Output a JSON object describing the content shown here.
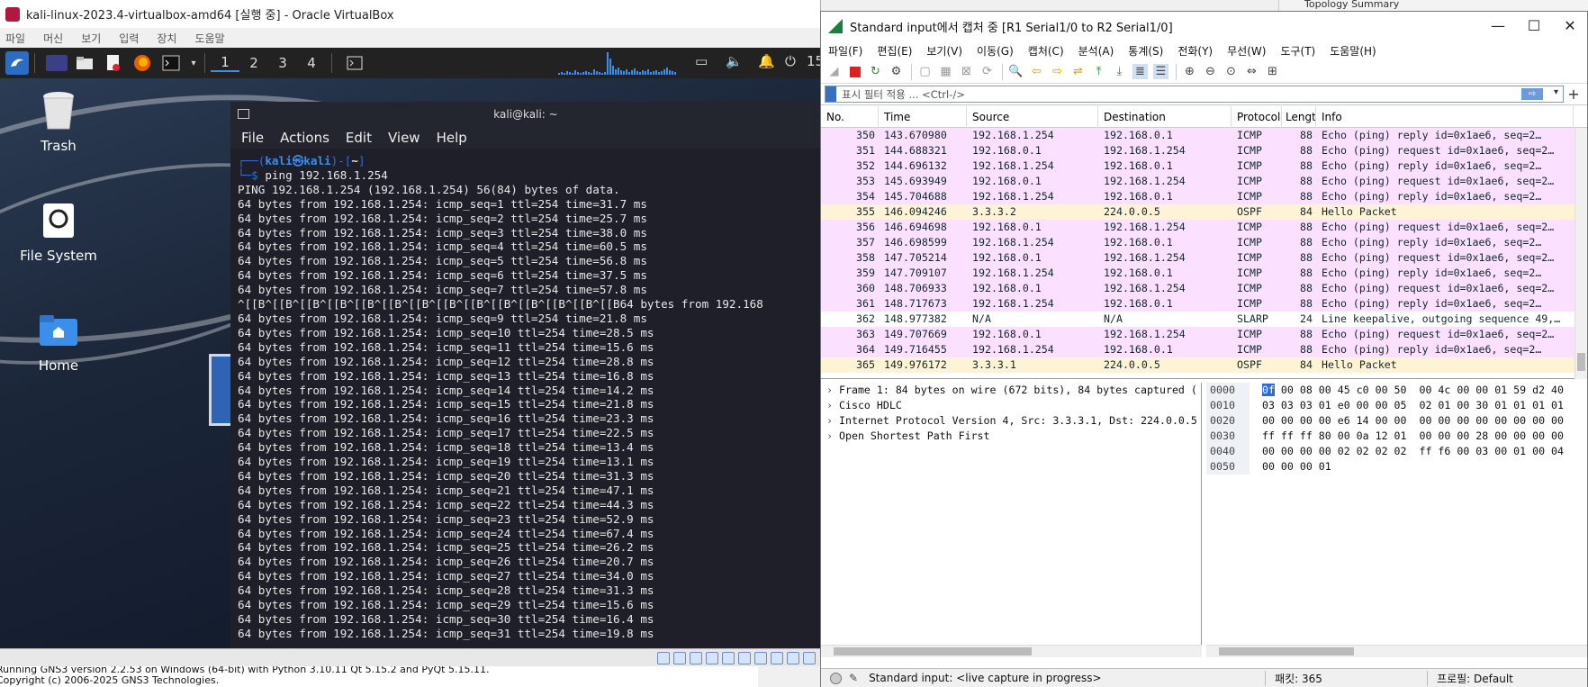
{
  "gns3": {
    "log_lines": [
      "Running GNS3 version 2.2.53 on Windows (64-bit) with Python 3.10.11 Qt 5.15.2 and PyQt 5.15.11.",
      "Copyright (c) 2006-2025 GNS3 Technologies."
    ],
    "topology_title": "Topology Summary"
  },
  "vbox": {
    "title": "kali-linux-2023.4-virtualbox-amd64 [실행 중] - Oracle VirtualBox",
    "menu": [
      "파일",
      "머신",
      "보기",
      "입력",
      "장치",
      "도움말"
    ]
  },
  "kali": {
    "workspaces": [
      "1",
      "2",
      "3",
      "4"
    ],
    "clock_partial": "15",
    "desktop_icons": [
      "Trash",
      "File System",
      "Home"
    ],
    "terminal": {
      "title": "kali@kali: ~",
      "menu": [
        "File",
        "Actions",
        "Edit",
        "View",
        "Help"
      ],
      "prompt_user": "kali",
      "prompt_host": "kali",
      "prompt_dir": "~",
      "command": "ping 192.168.1.254",
      "output_lines": [
        "PING 192.168.1.254 (192.168.1.254) 56(84) bytes of data.",
        "64 bytes from 192.168.1.254: icmp_seq=1 ttl=254 time=31.7 ms",
        "64 bytes from 192.168.1.254: icmp_seq=2 ttl=254 time=25.7 ms",
        "64 bytes from 192.168.1.254: icmp_seq=3 ttl=254 time=38.0 ms",
        "64 bytes from 192.168.1.254: icmp_seq=4 ttl=254 time=60.5 ms",
        "64 bytes from 192.168.1.254: icmp_seq=5 ttl=254 time=56.8 ms",
        "64 bytes from 192.168.1.254: icmp_seq=6 ttl=254 time=37.5 ms",
        "64 bytes from 192.168.1.254: icmp_seq=7 ttl=254 time=57.8 ms",
        "^[[B^[[B^[[B^[[B^[[B^[[B^[[B^[[B^[[B^[[B^[[B^[[B^[[B^[[B64 bytes from 192.168",
        "64 bytes from 192.168.1.254: icmp_seq=9 ttl=254 time=21.8 ms",
        "64 bytes from 192.168.1.254: icmp_seq=10 ttl=254 time=28.5 ms",
        "64 bytes from 192.168.1.254: icmp_seq=11 ttl=254 time=15.6 ms",
        "64 bytes from 192.168.1.254: icmp_seq=12 ttl=254 time=28.8 ms",
        "64 bytes from 192.168.1.254: icmp_seq=13 ttl=254 time=16.8 ms",
        "64 bytes from 192.168.1.254: icmp_seq=14 ttl=254 time=14.2 ms",
        "64 bytes from 192.168.1.254: icmp_seq=15 ttl=254 time=21.8 ms",
        "64 bytes from 192.168.1.254: icmp_seq=16 ttl=254 time=23.3 ms",
        "64 bytes from 192.168.1.254: icmp_seq=17 ttl=254 time=22.5 ms",
        "64 bytes from 192.168.1.254: icmp_seq=18 ttl=254 time=13.4 ms",
        "64 bytes from 192.168.1.254: icmp_seq=19 ttl=254 time=13.1 ms",
        "64 bytes from 192.168.1.254: icmp_seq=20 ttl=254 time=31.3 ms",
        "64 bytes from 192.168.1.254: icmp_seq=21 ttl=254 time=47.1 ms",
        "64 bytes from 192.168.1.254: icmp_seq=22 ttl=254 time=44.3 ms",
        "64 bytes from 192.168.1.254: icmp_seq=23 ttl=254 time=52.9 ms",
        "64 bytes from 192.168.1.254: icmp_seq=24 ttl=254 time=67.4 ms",
        "64 bytes from 192.168.1.254: icmp_seq=25 ttl=254 time=26.2 ms",
        "64 bytes from 192.168.1.254: icmp_seq=26 ttl=254 time=20.7 ms",
        "64 bytes from 192.168.1.254: icmp_seq=27 ttl=254 time=34.0 ms",
        "64 bytes from 192.168.1.254: icmp_seq=28 ttl=254 time=31.3 ms",
        "64 bytes from 192.168.1.254: icmp_seq=29 ttl=254 time=15.6 ms",
        "64 bytes from 192.168.1.254: icmp_seq=30 ttl=254 time=16.4 ms",
        "64 bytes from 192.168.1.254: icmp_seq=31 ttl=254 time=19.8 ms"
      ]
    }
  },
  "wireshark": {
    "title": "Standard input에서 캡처 중 [R1 Serial1/0 to R2 Serial1/0]",
    "menu": [
      "파일(F)",
      "편집(E)",
      "보기(V)",
      "이동(G)",
      "캡처(C)",
      "분석(A)",
      "통계(S)",
      "전화(Y)",
      "무선(W)",
      "도구(T)",
      "도움말(H)"
    ],
    "filter_placeholder": "표시 필터 적용 ... <Ctrl-/>",
    "columns": [
      "No.",
      "Time",
      "Source",
      "Destination",
      "Protocol",
      "Lengt",
      "Info"
    ],
    "colors": {
      "icmp": "#fce0ff",
      "ospf": "#fff3d6",
      "slarp": "#ffffff"
    },
    "packets": [
      {
        "no": "350",
        "time": "143.670980",
        "src": "192.168.1.254",
        "dst": "192.168.0.1",
        "proto": "ICMP",
        "len": "88",
        "info": "Echo (ping) reply    id=0x1ae6, seq=2…"
      },
      {
        "no": "351",
        "time": "144.688321",
        "src": "192.168.0.1",
        "dst": "192.168.1.254",
        "proto": "ICMP",
        "len": "88",
        "info": "Echo (ping) request  id=0x1ae6, seq=2…"
      },
      {
        "no": "352",
        "time": "144.696132",
        "src": "192.168.1.254",
        "dst": "192.168.0.1",
        "proto": "ICMP",
        "len": "88",
        "info": "Echo (ping) reply    id=0x1ae6, seq=2…"
      },
      {
        "no": "353",
        "time": "145.693949",
        "src": "192.168.0.1",
        "dst": "192.168.1.254",
        "proto": "ICMP",
        "len": "88",
        "info": "Echo (ping) request  id=0x1ae6, seq=2…"
      },
      {
        "no": "354",
        "time": "145.704688",
        "src": "192.168.1.254",
        "dst": "192.168.0.1",
        "proto": "ICMP",
        "len": "88",
        "info": "Echo (ping) reply    id=0x1ae6, seq=2…"
      },
      {
        "no": "355",
        "time": "146.094246",
        "src": "3.3.3.2",
        "dst": "224.0.0.5",
        "proto": "OSPF",
        "len": "84",
        "info": "Hello Packet"
      },
      {
        "no": "356",
        "time": "146.694698",
        "src": "192.168.0.1",
        "dst": "192.168.1.254",
        "proto": "ICMP",
        "len": "88",
        "info": "Echo (ping) request  id=0x1ae6, seq=2…"
      },
      {
        "no": "357",
        "time": "146.698599",
        "src": "192.168.1.254",
        "dst": "192.168.0.1",
        "proto": "ICMP",
        "len": "88",
        "info": "Echo (ping) reply    id=0x1ae6, seq=2…"
      },
      {
        "no": "358",
        "time": "147.705214",
        "src": "192.168.0.1",
        "dst": "192.168.1.254",
        "proto": "ICMP",
        "len": "88",
        "info": "Echo (ping) request  id=0x1ae6, seq=2…"
      },
      {
        "no": "359",
        "time": "147.709107",
        "src": "192.168.1.254",
        "dst": "192.168.0.1",
        "proto": "ICMP",
        "len": "88",
        "info": "Echo (ping) reply    id=0x1ae6, seq=2…"
      },
      {
        "no": "360",
        "time": "148.706933",
        "src": "192.168.0.1",
        "dst": "192.168.1.254",
        "proto": "ICMP",
        "len": "88",
        "info": "Echo (ping) request  id=0x1ae6, seq=2…"
      },
      {
        "no": "361",
        "time": "148.717673",
        "src": "192.168.1.254",
        "dst": "192.168.0.1",
        "proto": "ICMP",
        "len": "88",
        "info": "Echo (ping) reply    id=0x1ae6, seq=2…"
      },
      {
        "no": "362",
        "time": "148.977382",
        "src": "N/A",
        "dst": "N/A",
        "proto": "SLARP",
        "len": "24",
        "info": "Line keepalive, outgoing sequence 49,…"
      },
      {
        "no": "363",
        "time": "149.707669",
        "src": "192.168.0.1",
        "dst": "192.168.1.254",
        "proto": "ICMP",
        "len": "88",
        "info": "Echo (ping) request  id=0x1ae6, seq=2…"
      },
      {
        "no": "364",
        "time": "149.716455",
        "src": "192.168.1.254",
        "dst": "192.168.0.1",
        "proto": "ICMP",
        "len": "88",
        "info": "Echo (ping) reply    id=0x1ae6, seq=2…"
      },
      {
        "no": "365",
        "time": "149.976172",
        "src": "3.3.3.1",
        "dst": "224.0.0.5",
        "proto": "OSPF",
        "len": "84",
        "info": "Hello Packet"
      }
    ],
    "details": [
      "Frame 1: 84 bytes on wire (672 bits), 84 bytes captured (",
      "Cisco HDLC",
      "Internet Protocol Version 4, Src: 3.3.3.1, Dst: 224.0.0.5",
      "Open Shortest Path First"
    ],
    "bytes": [
      {
        "off": "0000",
        "first": "0f",
        "rest": " 00 08 00 45 c0 00 50  00 4c 00 00 01 59 d2 40"
      },
      {
        "off": "0010",
        "first": "",
        "rest": "03 03 03 01 e0 00 00 05  02 01 00 30 01 01 01 01"
      },
      {
        "off": "0020",
        "first": "",
        "rest": "00 00 00 00 e6 14 00 00  00 00 00 00 00 00 00 00"
      },
      {
        "off": "0030",
        "first": "",
        "rest": "ff ff ff 80 00 0a 12 01  00 00 00 28 00 00 00 00"
      },
      {
        "off": "0040",
        "first": "",
        "rest": "00 00 00 00 02 02 02 02  ff f6 00 03 00 01 00 04"
      },
      {
        "off": "0050",
        "first": "",
        "rest": "00 00 00 01"
      }
    ],
    "status_text": "Standard input: <live capture in progress>",
    "packets_label": "패킷: 365",
    "profile_label": "프로필: Default"
  }
}
